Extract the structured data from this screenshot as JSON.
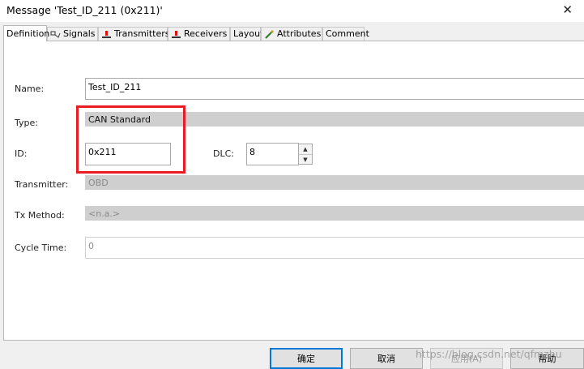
{
  "window": {
    "title": "Message 'Test_ID_211 (0x211)'",
    "close_label": "✕"
  },
  "tabs": [
    {
      "label": "Definition",
      "icon": "none"
    },
    {
      "label": "Signals",
      "icon": "signals-icon"
    },
    {
      "label": "Transmitters",
      "icon": "transmitter-icon"
    },
    {
      "label": "Receivers",
      "icon": "receiver-icon"
    },
    {
      "label": "Layout",
      "icon": "none"
    },
    {
      "label": "Attributes",
      "icon": "attributes-icon"
    },
    {
      "label": "Comment",
      "icon": "none"
    }
  ],
  "form": {
    "name_label": "Name:",
    "name_value": "Test_ID_211",
    "type_label": "Type:",
    "type_value": "CAN Standard",
    "id_label": "ID:",
    "id_value": "0x211",
    "dlc_label": "DLC:",
    "dlc_value": "8",
    "transmitter_label": "Transmitter:",
    "transmitter_value": "OBD",
    "tx_method_label": "Tx Method:",
    "tx_method_value": "<n.a.>",
    "cycle_time_label": "Cycle Time:",
    "cycle_time_value": "0"
  },
  "buttons": {
    "ok": "确定",
    "cancel": "取消",
    "apply": "应用(A)",
    "help": "帮助"
  },
  "watermark": "https://blog.csdn.net/qfmzhu",
  "colors": {
    "highlight_box": "#ec1c24",
    "readonly_bg": "#cfcfcf",
    "default_button_border": "#0078d7"
  }
}
